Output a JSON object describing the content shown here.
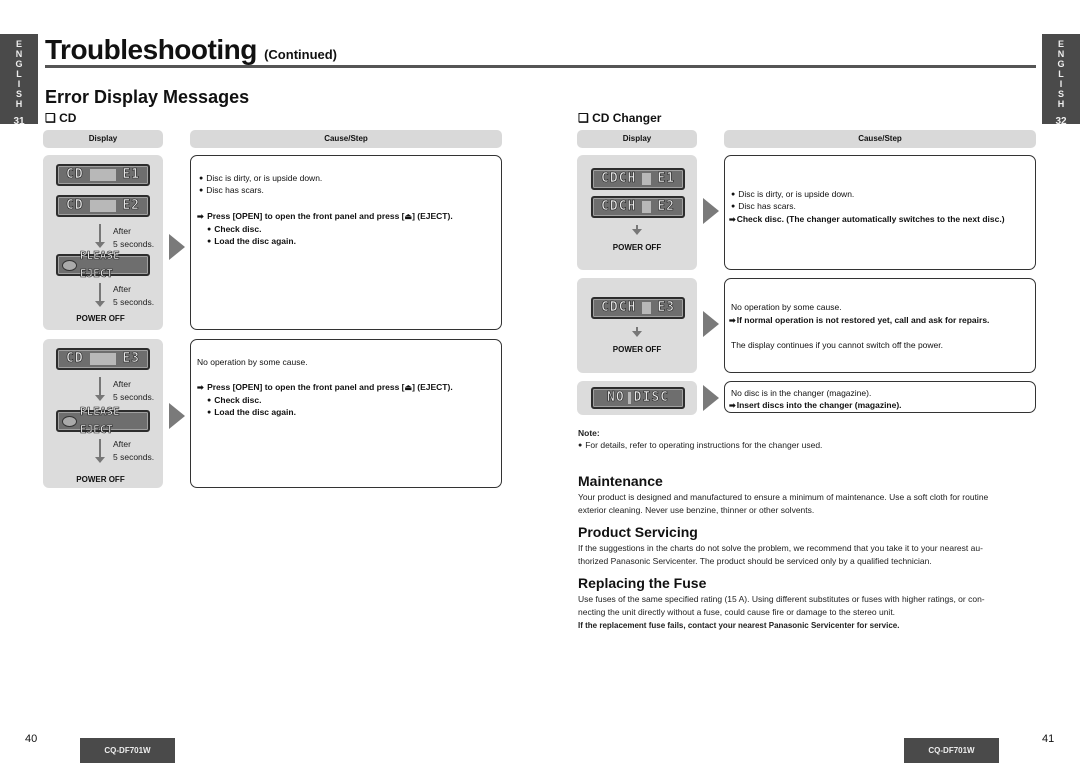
{
  "side_tabs": {
    "left": {
      "letters": [
        "E",
        "N",
        "G",
        "L",
        "I",
        "S",
        "H"
      ],
      "page": "31"
    },
    "right": {
      "letters": [
        "E",
        "N",
        "G",
        "L",
        "I",
        "S",
        "H"
      ],
      "page": "32"
    }
  },
  "header": {
    "title": "Troubleshooting",
    "continued": "(Continued)"
  },
  "error_section": {
    "title": "Error Display Messages",
    "cd": {
      "label": "❑ CD",
      "col_display": "Display",
      "col_cause": "Cause/Step",
      "group1": {
        "lcd1": {
          "left": "CD",
          "right": "E1"
        },
        "lcd2": {
          "left": "CD",
          "right": "E2"
        },
        "after1": [
          "After",
          "5 seconds."
        ],
        "eject": "PLEASE EJECT",
        "after2": [
          "After",
          "5 seconds."
        ],
        "power_off": "POWER OFF",
        "causes": [
          "Disc is dirty, or is upside down.",
          "Disc has scars."
        ],
        "step_prefix": "Press [OPEN] to open the front panel and press [",
        "step_suffix": "] (EJECT).",
        "eject_icon": "⏏",
        "substeps": [
          "Check disc.",
          "Load the disc again."
        ]
      },
      "group2": {
        "lcd1": {
          "left": "CD",
          "right": "E3"
        },
        "after1": [
          "After",
          "5 seconds."
        ],
        "eject": "PLEASE EJECT",
        "after2": [
          "After",
          "5 seconds."
        ],
        "power_off": "POWER OFF",
        "cause": "No operation by some cause.",
        "step_prefix": "Press [OPEN] to open the front panel and press [",
        "step_suffix": "] (EJECT).",
        "eject_icon": "⏏",
        "substeps": [
          "Check disc.",
          "Load the disc again."
        ]
      }
    },
    "changer": {
      "label": "❑ CD Changer",
      "col_display": "Display",
      "col_cause": "Cause/Step",
      "group1": {
        "lcd1": {
          "left": "CDCH",
          "right": "E1"
        },
        "lcd2": {
          "left": "CDCH",
          "right": "E2"
        },
        "power_off": "POWER OFF",
        "causes": [
          "Disc is dirty, or is upside down.",
          "Disc has scars."
        ],
        "step": "Check disc. (The changer automatically switches to the next disc.)"
      },
      "group2": {
        "lcd1": {
          "left": "CDCH",
          "right": "E3"
        },
        "power_off": "POWER OFF",
        "cause": "No operation by some cause.",
        "step": "If normal operation is not restored yet, call and ask for repairs.",
        "note": "The display continues if you cannot switch off the power."
      },
      "group3": {
        "lcd1": {
          "left": "NO",
          "right": "DISC"
        },
        "cause": "No disc is in the changer (magazine).",
        "step": "Insert discs into the changer (magazine)."
      }
    },
    "note": {
      "label": "Note:",
      "text": "For details, refer to operating instructions for the changer used."
    }
  },
  "maintenance": {
    "title": "Maintenance",
    "lines": [
      "Your product is designed and manufactured to ensure a minimum of maintenance. Use a soft cloth for routine",
      "exterior cleaning. Never use benzine, thinner or other solvents."
    ]
  },
  "servicing": {
    "title": "Product Servicing",
    "lines": [
      "If the suggestions in the charts do not solve the problem, we recommend that you take it to your nearest au-",
      "thorized Panasonic Servicenter. The product should be serviced only by a qualified technician."
    ]
  },
  "fuse": {
    "title": "Replacing the Fuse",
    "lines": [
      "Use fuses of the same specified rating (15 A). Using different substitutes or fuses with higher ratings, or con-",
      "necting the unit directly without a fuse, could cause fire or damage to the stereo unit."
    ],
    "bold_line": "If the replacement fuse fails, contact your nearest Panasonic Servicenter for service."
  },
  "footer": {
    "left_page": "40",
    "right_page": "41",
    "model": "CQ-DF701W"
  }
}
